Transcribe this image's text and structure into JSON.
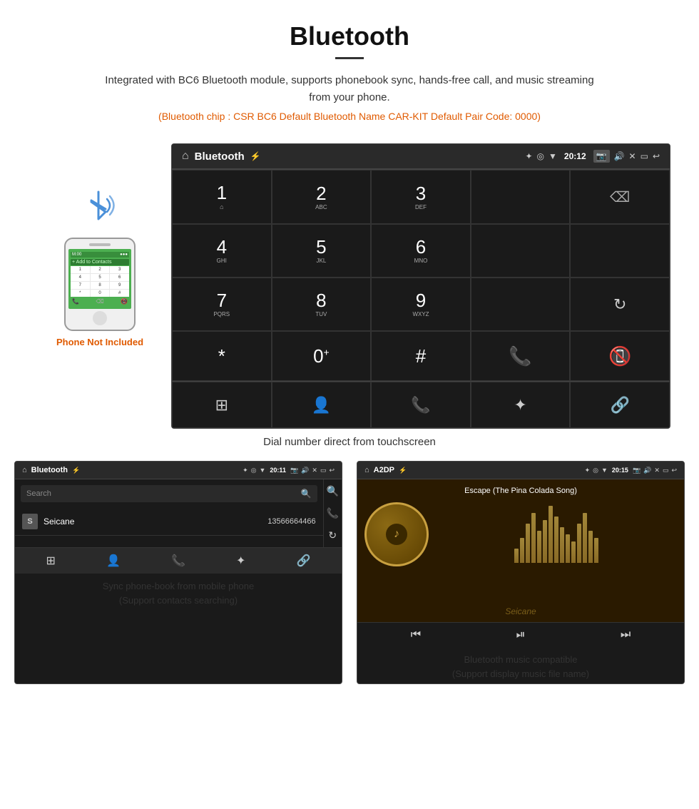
{
  "header": {
    "title": "Bluetooth",
    "description": "Integrated with BC6 Bluetooth module, supports phonebook sync, hands-free call, and music streaming from your phone.",
    "specs": "(Bluetooth chip : CSR BC6    Default Bluetooth Name CAR-KIT    Default Pair Code: 0000)"
  },
  "phone_side": {
    "not_included_label": "Phone Not Included"
  },
  "car_dialpad": {
    "screen_title": "Bluetooth",
    "keys": [
      {
        "num": "1",
        "sub": ""
      },
      {
        "num": "2",
        "sub": "ABC"
      },
      {
        "num": "3",
        "sub": "DEF"
      },
      {
        "num": "4",
        "sub": "GHI"
      },
      {
        "num": "5",
        "sub": "JKL"
      },
      {
        "num": "6",
        "sub": "MNO"
      },
      {
        "num": "7",
        "sub": "PQRS"
      },
      {
        "num": "8",
        "sub": "TUV"
      },
      {
        "num": "9",
        "sub": "WXYZ"
      },
      {
        "num": "*",
        "sub": ""
      },
      {
        "num": "0",
        "sub": "+"
      },
      {
        "num": "#",
        "sub": ""
      }
    ],
    "caption": "Dial number direct from touchscreen"
  },
  "phonebook_screen": {
    "title": "Bluetooth",
    "search_placeholder": "Search",
    "contact": {
      "initial": "S",
      "name": "Seicane",
      "number": "13566664466"
    },
    "bottom_caption": "Sync phone-book from mobile phone\n(Support contacts searching)"
  },
  "music_screen": {
    "title": "A2DP",
    "song_title": "Escape (The Pina Colada Song)",
    "bottom_caption": "Bluetooth music compatible\n(Support display music file name)"
  },
  "watermark": "Seicane",
  "eq_bars": [
    20,
    35,
    55,
    70,
    45,
    60,
    80,
    65,
    50,
    40,
    30,
    55,
    70,
    45,
    35
  ],
  "status_time_main": "20:12",
  "status_time_pb": "20:11",
  "status_time_music": "20:15"
}
